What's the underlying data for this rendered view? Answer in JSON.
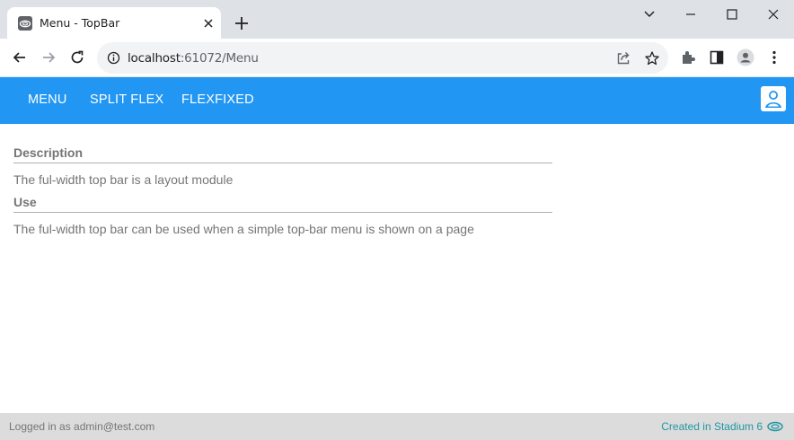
{
  "browser": {
    "tab_title": "Menu - TopBar",
    "url_host": "localhost",
    "url_rest": ":61072/Menu"
  },
  "topbar": {
    "menu_items": [
      "MENU",
      "SPLIT FLEX",
      "FLEXFIXED"
    ],
    "accent_color": "#2196f3"
  },
  "content": {
    "description_heading": "Description",
    "description_text": "The ful-width top bar is a layout module",
    "use_heading": "Use",
    "use_text": "The ful-width top bar can be used when a simple top-bar menu is shown on a page"
  },
  "footer": {
    "logged_in": "Logged in as admin@test.com",
    "created": "Created in Stadium 6"
  }
}
